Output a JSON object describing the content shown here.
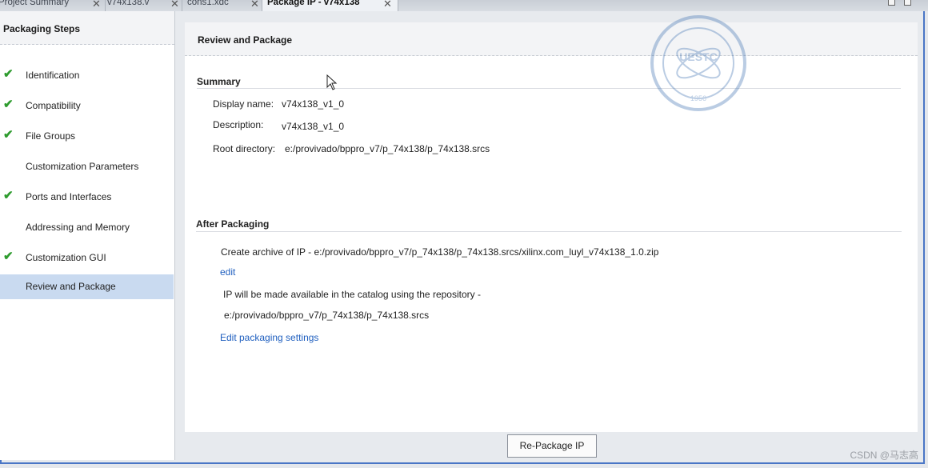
{
  "tabs": [
    {
      "label": "Project Summary",
      "active": false
    },
    {
      "label": "v74x138.v",
      "active": false
    },
    {
      "label": "cons1.xdc",
      "active": false
    },
    {
      "label": "Package IP - v74x138",
      "active": true
    }
  ],
  "left_panel": {
    "title": "Packaging Steps",
    "steps": [
      {
        "label": "Identification",
        "done": true
      },
      {
        "label": "Compatibility",
        "done": true
      },
      {
        "label": "File Groups",
        "done": true
      },
      {
        "label": "Customization Parameters",
        "done": false
      },
      {
        "label": "Ports and Interfaces",
        "done": true
      },
      {
        "label": "Addressing and Memory",
        "done": false
      },
      {
        "label": "Customization GUI",
        "done": true
      },
      {
        "label": "Review and Package",
        "done": false,
        "selected": true
      }
    ]
  },
  "main": {
    "title": "Review and Package",
    "summary": {
      "title": "Summary",
      "display_name_label": "Display name:",
      "display_name_value": "v74x138_v1_0",
      "description_label": "Description:",
      "description_value": "v74x138_v1_0",
      "root_dir_label": "Root directory:",
      "root_dir_value": "e:/provivado/bppro_v7/p_74x138/p_74x138.srcs"
    },
    "after_packaging": {
      "title": "After Packaging",
      "archive_text": "Create archive of IP - e:/provivado/bppro_v7/p_74x138/p_74x138.srcs/xilinx.com_luyl_v74x138_1.0.zip",
      "edit_link": "edit",
      "catalog_text": "IP will be made available in the catalog using the repository -",
      "catalog_path": "e:/provivado/bppro_v7/p_74x138/p_74x138.srcs",
      "settings_link": "Edit packaging settings"
    },
    "button_label": "Re-Package IP"
  },
  "watermark": {
    "text": "UESTC",
    "year": "1956"
  },
  "credit": "CSDN @马志高",
  "colors": {
    "frame_blue": "#4a76c6",
    "check_green": "#2e9b2e",
    "link_blue": "#1f5fbf",
    "selected_bg": "#c9daf0"
  }
}
